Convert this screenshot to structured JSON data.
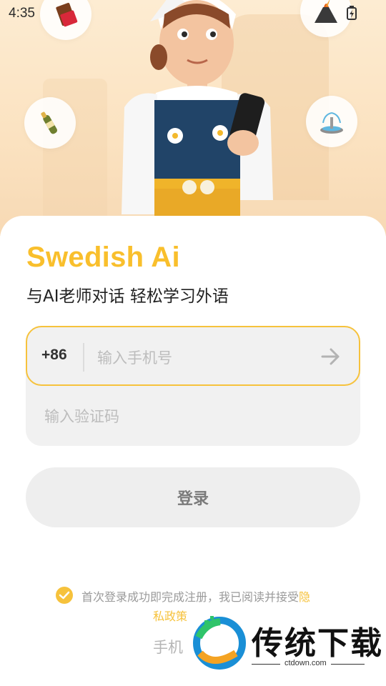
{
  "status_bar": {
    "time": "4:35"
  },
  "app": {
    "title": "Swedish Ai",
    "subtitle": "与AI老师对话 轻松学习外语"
  },
  "hero": {
    "bubbles": [
      "chocolate-icon",
      "volcano-icon",
      "champagne-icon",
      "fountain-icon"
    ]
  },
  "login_form": {
    "country_code": "+86",
    "phone_placeholder": "输入手机号",
    "code_placeholder": "输入验证码",
    "login_label": "登录"
  },
  "agreement": {
    "text": "首次登录成功即完成注册，我已阅读并接受",
    "link_part1": "隐",
    "link_part2": "私政策"
  },
  "alt_login": {
    "label": "手机"
  },
  "watermark": {
    "name": "传统下载",
    "url": "ctdown.com"
  },
  "colors": {
    "accent": "#f9bf2c",
    "input_bg": "#f1f1f1",
    "button_bg": "#eeeeee"
  }
}
